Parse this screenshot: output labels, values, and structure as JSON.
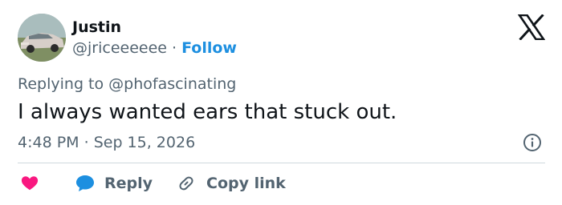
{
  "tweet": {
    "author_name": "Justin",
    "author_handle": "@jriceeeeee",
    "separator": "·",
    "follow_label": "Follow",
    "reply_prefix": "Replying to ",
    "reply_to_handle": "@phofascinating",
    "text": "I always wanted ears that stuck out.",
    "time": "4:48 PM",
    "date": "Sep 15, 2026"
  },
  "actions": {
    "like_icon": "heart-icon",
    "reply_label": "Reply",
    "reply_icon": "speech-bubble-icon",
    "copy_label": "Copy link",
    "copy_icon": "link-icon"
  },
  "icons": {
    "logo": "x-logo-icon",
    "info": "info-icon"
  },
  "colors": {
    "accent": "#1d8fe0",
    "like": "#f91880",
    "text_primary": "#0f1419",
    "text_secondary": "#536471",
    "divider": "#cfd9de"
  }
}
